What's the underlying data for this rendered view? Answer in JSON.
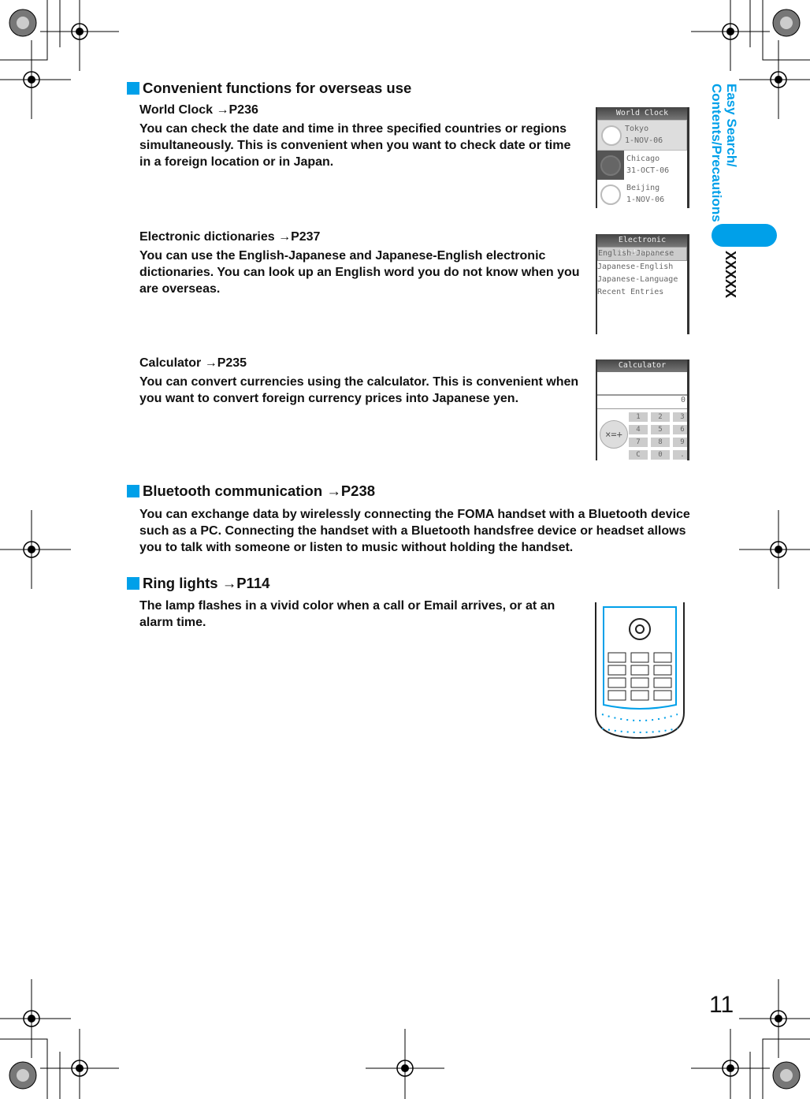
{
  "side_tab": {
    "line1": "Easy Search/",
    "line2": "Contents/Precautions",
    "section": "XXXXX",
    "color": "#00a0e9"
  },
  "sections": [
    {
      "title": "Convenient functions for overseas use"
    },
    {
      "title": "Bluetooth communication",
      "ref": "P238",
      "body": "You can exchange data by wirelessly connecting the FOMA handset with a Bluetooth device such as a PC. Connecting the handset with a Bluetooth handsfree device or headset allows you to talk with someone or listen to music without holding the handset."
    },
    {
      "title": "Ring lights",
      "ref": "P114",
      "body": "The lamp flashes in a vivid color when a call or Email arrives, or at an alarm time."
    }
  ],
  "features": [
    {
      "title": "World Clock",
      "ref": "P236",
      "body": "You can check the date and time in three specified countries or regions simultaneously. This is convenient when you want to check date or time in a foreign location or in Japan."
    },
    {
      "title": "Electronic dictionaries",
      "ref": "P237",
      "body": "You can use the English-Japanese and Japanese-English electronic dictionaries. You can look up an English word you do not know when you are overseas."
    },
    {
      "title": "Calculator",
      "ref": "P235",
      "body": "You can convert currencies using the calculator. This is convenient when you want to convert foreign currency prices into Japanese yen."
    }
  ],
  "screens": {
    "world_clock": {
      "title": "World Clock",
      "rows": [
        {
          "city": "Tokyo",
          "date": "1-NOV-06"
        },
        {
          "city": "Chicago",
          "date": "31-OCT-06"
        },
        {
          "city": "Beijing",
          "date": "1-NOV-06"
        }
      ]
    },
    "dictionary": {
      "title": "Electronic Dictionary",
      "items": [
        "English-Japanese",
        "Japanese-English",
        "Japanese-Language",
        "Recent Entries"
      ]
    },
    "calculator": {
      "title": "Calculator",
      "display": "0",
      "keys": [
        "1",
        "2",
        "3",
        "4",
        "5",
        "6",
        "7",
        "8",
        "9",
        "C",
        "0",
        "."
      ]
    }
  },
  "arrow": "→",
  "page_number": "11"
}
